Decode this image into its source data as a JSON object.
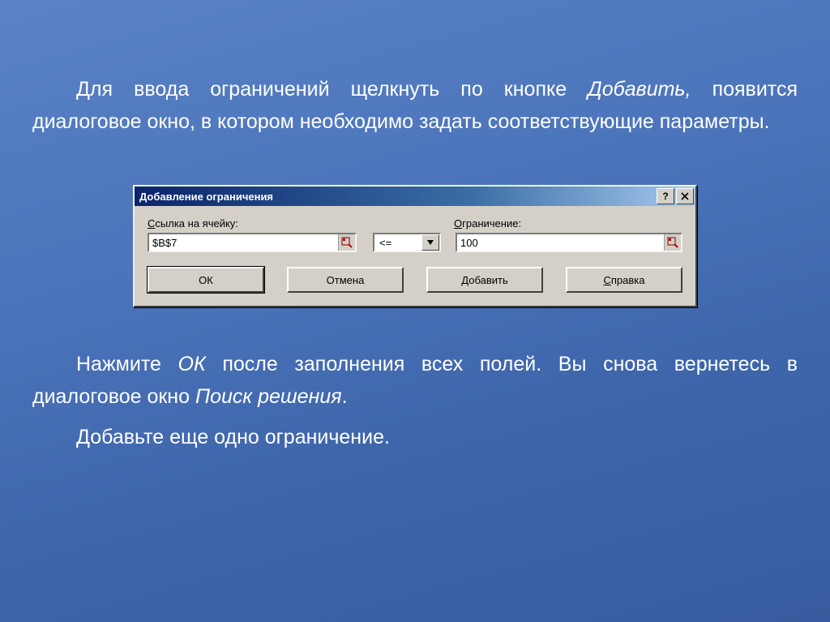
{
  "text": {
    "p1a": "Для ввода ограничений щелкнуть по кнопке ",
    "p1b": "Добавить,",
    "p1c": " появится диалоговое окно, в котором необходимо задать соответствующие параметры.",
    "p2a": "Нажмите ",
    "p2b": "ОК",
    "p2c": " после заполнения всех полей. Вы снова вернетесь в диалоговое окно ",
    "p2d": "Поиск решения",
    "p2e": ".",
    "p3": "Добавьте еще одно ограничение."
  },
  "dialog": {
    "title": "Добавление ограничения",
    "help_symbol": "?",
    "labels": {
      "cell_ref": "Ссылка на ячейку:",
      "constraint": "Ограничение:"
    },
    "fields": {
      "cell_ref_value": "$B$7",
      "operator_value": "<=",
      "constraint_value": "100"
    },
    "buttons": {
      "ok": "ОК",
      "cancel": "Отмена",
      "add": "Добавить",
      "help": "Справка"
    }
  }
}
